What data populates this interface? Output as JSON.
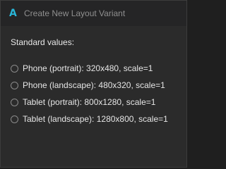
{
  "window": {
    "logo_letter": "A",
    "title": "Create New Layout Variant"
  },
  "section": {
    "label": "Standard values:"
  },
  "options": [
    {
      "label": "Phone (portrait): 320x480, scale=1",
      "selected": false
    },
    {
      "label": "Phone (landscape): 480x320, scale=1",
      "selected": false
    },
    {
      "label": "Tablet (portrait): 800x1280, scale=1",
      "selected": false
    },
    {
      "label": "Tablet (landscape): 1280x800, scale=1",
      "selected": false
    }
  ],
  "colors": {
    "accent": "#29b6d8",
    "background": "#2b2b2b",
    "titlebar": "#252526"
  }
}
